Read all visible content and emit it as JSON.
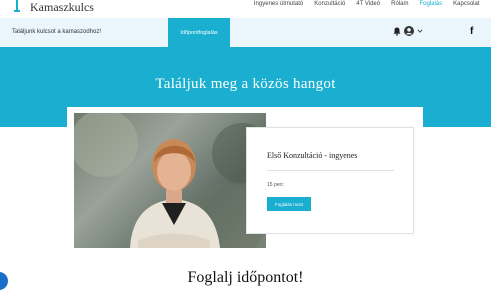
{
  "brand": {
    "name": "Kamaszkulcs"
  },
  "nav": {
    "links": [
      {
        "label": "Ingyenes útmutató",
        "active": false
      },
      {
        "label": "Konzultáció",
        "active": false
      },
      {
        "label": "4T Videó",
        "active": false
      },
      {
        "label": "Rólam",
        "active": false
      },
      {
        "label": "Foglalás",
        "active": true
      },
      {
        "label": "Kapcsolat",
        "active": false
      }
    ]
  },
  "subbar": {
    "tagline": "Találjunk kulcsot a kamaszodhoz!",
    "book_label": "Időpontfoglalás",
    "icons": [
      "bell-icon",
      "avatar-icon",
      "chevron-down-icon",
      "facebook-icon"
    ]
  },
  "hero": {
    "title": "Találjuk meg a közös hangot"
  },
  "service": {
    "title": "Első Konzultáció - ingyenes",
    "duration": "15 perc",
    "button_label": "Foglalás most"
  },
  "section": {
    "heading": "Foglalj időpontot!"
  },
  "colors": {
    "accent": "#1aaed0",
    "subbar_bg": "#eaf6fb",
    "chat": "#1a6fc8"
  }
}
